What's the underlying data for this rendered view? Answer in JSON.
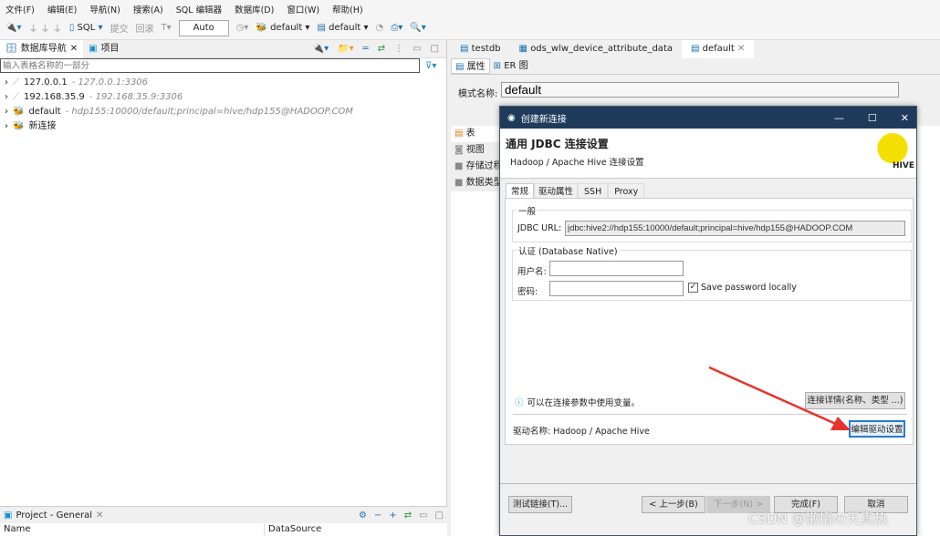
{
  "menu": [
    "文件(F)",
    "编辑(E)",
    "导航(N)",
    "搜索(A)",
    "SQL 编辑器",
    "数据库(D)",
    "窗口(W)",
    "帮助(H)"
  ],
  "toolbar": {
    "sql": "SQL",
    "commit": "提交",
    "rollback": "回滚",
    "mode": "Auto",
    "datasource": "default",
    "schema": "default"
  },
  "navigator": {
    "tab1": "数据库导航",
    "tab2": "项目",
    "filter_placeholder": "输入表格名称的一部分",
    "items": [
      {
        "name": "127.0.0.1",
        "detail": "- 127.0.0.1:3306"
      },
      {
        "name": "192.168.35.9",
        "detail": "- 192.168.35.9:3306"
      },
      {
        "name": "default",
        "detail": "- hdp155:10000/default;principal=hive/hdp155@HADOOP.COM"
      },
      {
        "name": "新连接",
        "detail": ""
      }
    ]
  },
  "project": {
    "title": "Project - General",
    "col_name": "Name",
    "col_ds": "DataSource"
  },
  "editor": {
    "tabs": [
      "testdb",
      "ods_wlw_device_attribute_data",
      "default"
    ],
    "subtabs": [
      "属性",
      "ER 图"
    ],
    "schema_label": "模式名称:",
    "schema_value": "default",
    "side_items": [
      "表",
      "视图",
      "存储过程",
      "数据类型"
    ]
  },
  "dialog": {
    "title": "创建新连接",
    "heading": "通用 JDBC 连接设置",
    "subheading": "Hadoop / Apache Hive 连接设置",
    "logo": "HIVE",
    "tabs": [
      "常规",
      "驱动属性",
      "SSH",
      "Proxy"
    ],
    "general_label": "一般",
    "jdbc_label": "JDBC URL:",
    "jdbc_value": "jdbc:hive2://hdp155:10000/default;principal=hive/hdp155@HADOOP.COM",
    "auth_label": "认证 (Database Native)",
    "user_label": "用户名:",
    "user_value": "",
    "pwd_label": "密码:",
    "pwd_value": "",
    "save_pwd": "Save password locally",
    "save_pwd_checked": true,
    "info": "可以在连接参数中使用变量。",
    "details_btn": "连接详情(名称、类型 ...)",
    "driver_label": "驱动名称:",
    "driver_value": "Hadoop / Apache Hive",
    "edit_driver_btn": "编辑驱动设置",
    "test_btn": "测试链接(T)...",
    "back_btn": "< 上一步(B)",
    "next_btn": "下一步(N) >",
    "finish_btn": "完成(F)",
    "cancel_btn": "取消"
  },
  "watermark": "CSDN @懒惰の天真热",
  "colors": {
    "title_bar": "#1f3b5c",
    "arrow": "#e8332a"
  }
}
